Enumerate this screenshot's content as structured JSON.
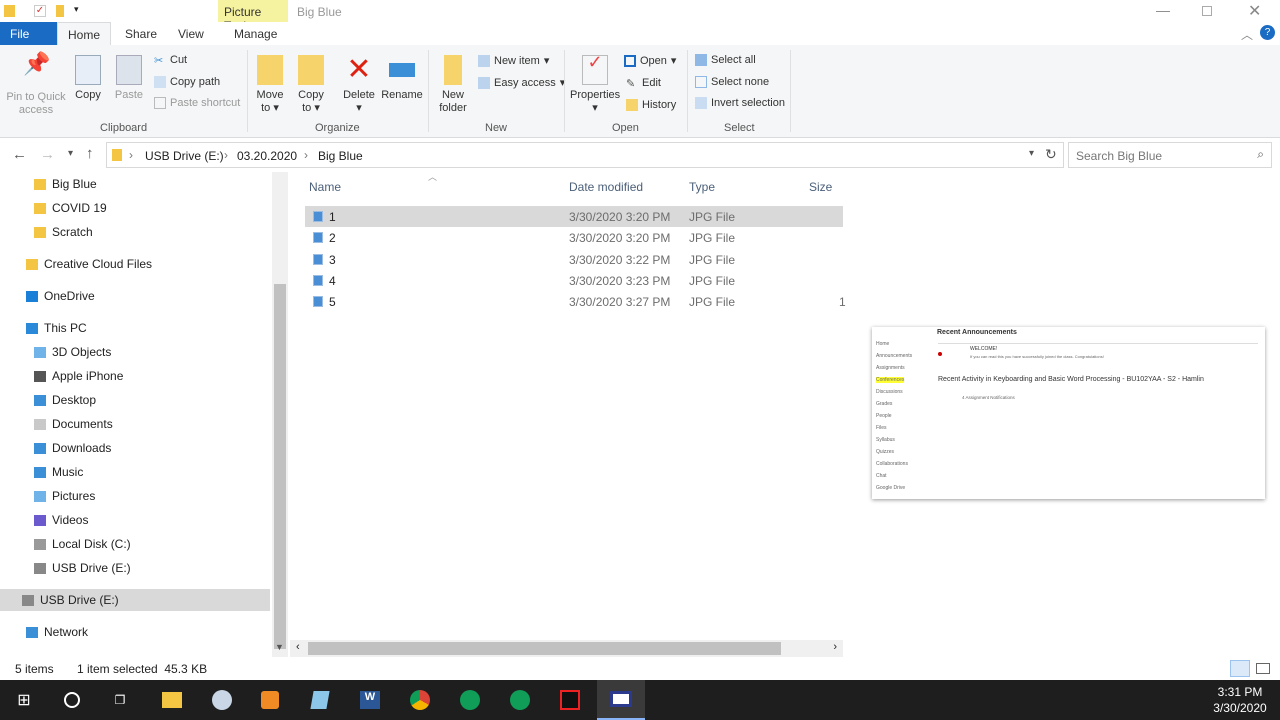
{
  "titlebar": {
    "context_tab": "Picture Tools",
    "window_title": "Big Blue"
  },
  "tabs": [
    {
      "label": "File"
    },
    {
      "label": "Home"
    },
    {
      "label": "Share"
    },
    {
      "label": "View"
    },
    {
      "label": "Manage"
    }
  ],
  "ribbon": {
    "pin": "Pin to Quick access",
    "copy": "Copy",
    "paste": "Paste",
    "cut": "Cut",
    "copy_path": "Copy path",
    "paste_shortcut": "Paste shortcut",
    "clipboard": "Clipboard",
    "move_to": "Move to",
    "copy_to": "Copy to",
    "delete": "Delete",
    "rename": "Rename",
    "organize": "Organize",
    "new_folder": "New folder",
    "new_item": "New item",
    "easy_access": "Easy access",
    "new": "New",
    "properties": "Properties",
    "open": "Open",
    "edit": "Edit",
    "history": "History",
    "open_group": "Open",
    "select_all": "Select all",
    "select_none": "Select none",
    "invert_selection": "Invert selection",
    "select": "Select"
  },
  "address": {
    "crumbs": [
      "USB Drive (E:)",
      "03.20.2020",
      "Big Blue"
    ],
    "search_placeholder": "Search Big Blue"
  },
  "nav": [
    {
      "label": "Big Blue",
      "icon": "folder-icon"
    },
    {
      "label": "COVID 19",
      "icon": "folder-icon"
    },
    {
      "label": "Scratch",
      "icon": "folder-icon"
    },
    {
      "label": "Creative Cloud Files",
      "icon": "creative-cloud-icon"
    },
    {
      "label": "OneDrive",
      "icon": "cloud-icon"
    },
    {
      "label": "This PC",
      "icon": "pc-icon"
    },
    {
      "label": "3D Objects",
      "icon": "3d-objects-icon"
    },
    {
      "label": "Apple iPhone",
      "icon": "phone-icon"
    },
    {
      "label": "Desktop",
      "icon": "desktop-icon"
    },
    {
      "label": "Documents",
      "icon": "documents-icon"
    },
    {
      "label": "Downloads",
      "icon": "downloads-icon"
    },
    {
      "label": "Music",
      "icon": "music-icon"
    },
    {
      "label": "Pictures",
      "icon": "pictures-icon"
    },
    {
      "label": "Videos",
      "icon": "videos-icon"
    },
    {
      "label": "Local Disk (C:)",
      "icon": "disk-icon"
    },
    {
      "label": "USB Drive (E:)",
      "icon": "usb-drive-icon"
    },
    {
      "label": "USB Drive (E:)",
      "icon": "usb-drive-icon",
      "selected": true
    },
    {
      "label": "Network",
      "icon": "network-icon"
    }
  ],
  "columns": {
    "name": "Name",
    "date": "Date modified",
    "type": "Type",
    "size": "Size"
  },
  "files": [
    {
      "name": "1",
      "date": "3/30/2020 3:20 PM",
      "type": "JPG File",
      "selected": true
    },
    {
      "name": "2",
      "date": "3/30/2020 3:20 PM",
      "type": "JPG File"
    },
    {
      "name": "3",
      "date": "3/30/2020 3:22 PM",
      "type": "JPG File"
    },
    {
      "name": "4",
      "date": "3/30/2020 3:23 PM",
      "type": "JPG File"
    },
    {
      "name": "5",
      "date": "3/30/2020 3:27 PM",
      "type": "JPG File",
      "size": "1"
    }
  ],
  "preview": {
    "heading1": "Recent Announcements",
    "welcome": "WELCOME!",
    "welcome_text": "If you can read this you have successfully joined the class. Congratulations!",
    "heading2": "Recent Activity in Keyboarding and Basic Word Processing - BU102YAA - S2 - Hamlin",
    "notif": "4 Assignment Notifications",
    "menu": [
      "Home",
      "Announcements",
      "Assignments",
      "Conferences",
      "Discussions",
      "Grades",
      "People",
      "Files",
      "Syllabus",
      "Quizzes",
      "Collaborations",
      "Chat",
      "Google Drive"
    ]
  },
  "status": {
    "items": "5 items",
    "selected": "1 item selected  45.3 KB"
  },
  "taskbar": {
    "time": "3:31 PM",
    "date": "3/30/2020"
  },
  "colors": {
    "accent": "#1a6bc4",
    "context_tab": "#f6f3a0",
    "selection": "#d9d9d9",
    "taskbar": "#1e1e1e"
  }
}
